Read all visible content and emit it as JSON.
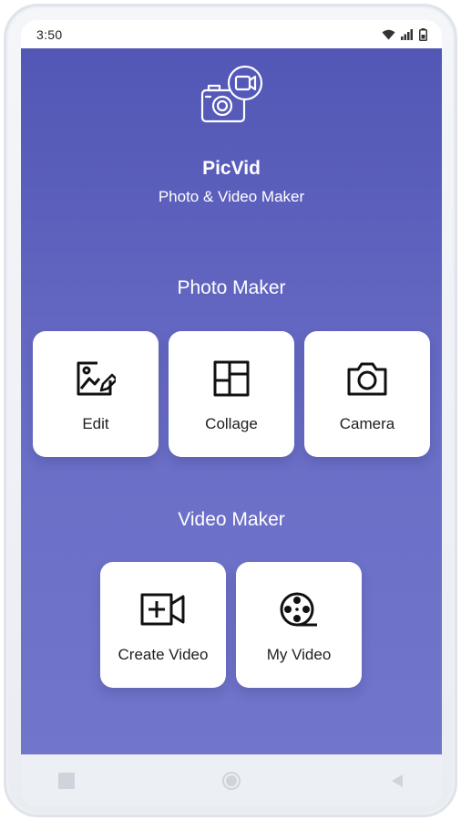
{
  "status_bar": {
    "time": "3:50"
  },
  "app": {
    "title": "PicVid",
    "subtitle": "Photo & Video Maker"
  },
  "photo_section": {
    "title": "Photo Maker",
    "items": [
      {
        "label": "Edit",
        "icon": "edit-image-icon"
      },
      {
        "label": "Collage",
        "icon": "collage-icon"
      },
      {
        "label": "Camera",
        "icon": "camera-icon"
      }
    ]
  },
  "video_section": {
    "title": "Video Maker",
    "items": [
      {
        "label": "Create Video",
        "icon": "add-video-icon"
      },
      {
        "label": "My Video",
        "icon": "film-reel-icon"
      }
    ]
  },
  "nav_bar": {
    "items": [
      "recent-apps",
      "home",
      "back"
    ]
  },
  "colors": {
    "gradient_top": "#5256b5",
    "gradient_bottom": "#7175cb",
    "card": "#ffffff"
  }
}
